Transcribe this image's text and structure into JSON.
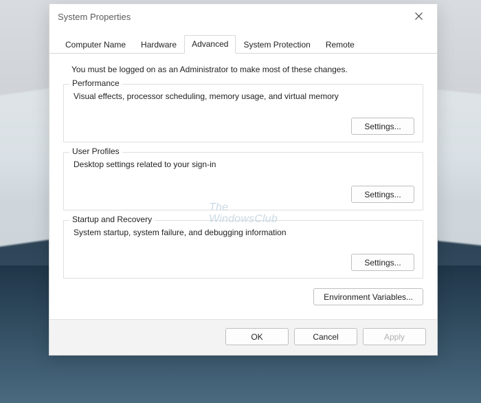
{
  "window": {
    "title": "System Properties"
  },
  "tabs": {
    "items": [
      "Computer Name",
      "Hardware",
      "Advanced",
      "System Protection",
      "Remote"
    ],
    "active_index": 2
  },
  "advanced": {
    "intro": "You must be logged on as an Administrator to make most of these changes.",
    "performance": {
      "title": "Performance",
      "description": "Visual effects, processor scheduling, memory usage, and virtual memory",
      "button": "Settings..."
    },
    "user_profiles": {
      "title": "User Profiles",
      "description": "Desktop settings related to your sign-in",
      "button": "Settings..."
    },
    "startup_recovery": {
      "title": "Startup and Recovery",
      "description": "System startup, system failure, and debugging information",
      "button": "Settings..."
    },
    "env_button": "Environment Variables..."
  },
  "footer": {
    "ok": "OK",
    "cancel": "Cancel",
    "apply": "Apply"
  },
  "watermark": {
    "line1": "The",
    "line2": "WindowsClub"
  }
}
